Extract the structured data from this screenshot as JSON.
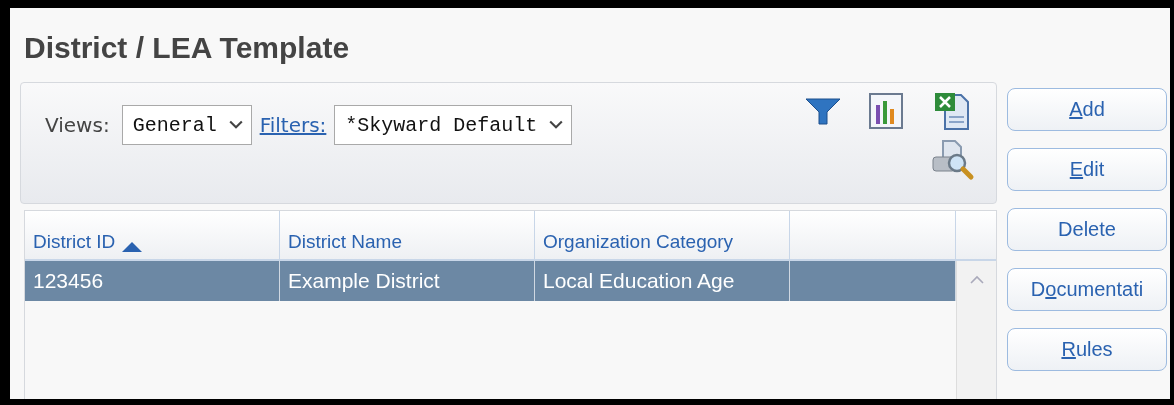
{
  "title": "District / LEA Template",
  "toolbar": {
    "views_label": "Views:",
    "views_value": "General",
    "filters_link": "Filters:",
    "filters_value": "*Skyward Default"
  },
  "table": {
    "columns": [
      {
        "label": "District ID",
        "sorted": true
      },
      {
        "label": "District Name",
        "sorted": false
      },
      {
        "label": "Organization Category",
        "sorted": false
      }
    ],
    "rows": [
      {
        "selected": true,
        "cells": [
          "123456",
          "Example District",
          "Local Education Age"
        ]
      }
    ]
  },
  "buttons": [
    {
      "key": "A",
      "after": "dd"
    },
    {
      "key": "E",
      "after": "dit"
    },
    {
      "before": "Delete"
    },
    {
      "before": "D",
      "key": "o",
      "after": "cumentati"
    },
    {
      "key": "R",
      "after": "ules"
    }
  ]
}
